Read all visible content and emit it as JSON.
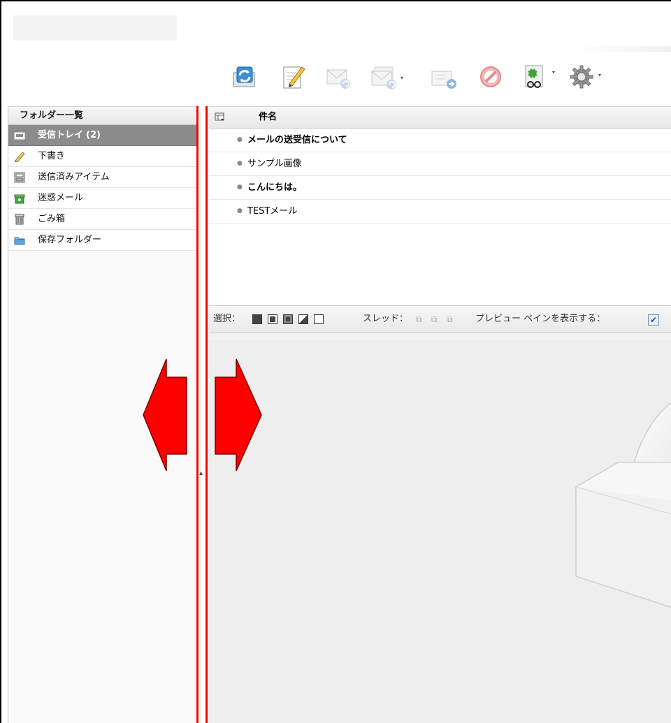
{
  "toolbar": {
    "buttons": [
      {
        "icon": "refresh-mail-icon",
        "enabled": true
      },
      {
        "icon": "compose-icon",
        "enabled": true
      },
      {
        "icon": "reply-icon",
        "enabled": false
      },
      {
        "icon": "reply-all-icon",
        "enabled": false
      },
      {
        "icon": "forward-icon",
        "enabled": false
      },
      {
        "icon": "delete-icon",
        "enabled": false
      },
      {
        "icon": "mark-icon",
        "enabled": true
      },
      {
        "icon": "settings-gear-icon",
        "enabled": true
      }
    ]
  },
  "folders": {
    "header": "フォルダー一覧",
    "items": [
      {
        "label": "受信トレイ",
        "count": "(2)",
        "icon": "inbox-icon",
        "selected": true
      },
      {
        "label": "下書き",
        "count": "",
        "icon": "pencil-icon",
        "selected": false
      },
      {
        "label": "送信済みアイテム",
        "count": "",
        "icon": "sent-icon",
        "selected": false
      },
      {
        "label": "迷惑メール",
        "count": "",
        "icon": "junk-icon",
        "selected": false
      },
      {
        "label": "ごみ箱",
        "count": "",
        "icon": "trash-icon",
        "selected": false
      },
      {
        "label": "保存フォルダー",
        "count": "",
        "icon": "folder-icon",
        "selected": false
      }
    ]
  },
  "mail_list": {
    "column_header": "件名",
    "rows": [
      {
        "subject": "メールの送受信について",
        "unread": true
      },
      {
        "subject": "サンプル画像",
        "unread": false
      },
      {
        "subject": "こんにちは。",
        "unread": true
      },
      {
        "subject": "TESTメール",
        "unread": false
      }
    ]
  },
  "select_bar": {
    "select_label": "選択：",
    "thread_label": "スレッド：",
    "preview_label": "プレビュー ペインを表示する：",
    "preview_checked": true
  },
  "colors": {
    "accent_red": "#ff0000",
    "selected_folder_bg": "#8c8c8c"
  }
}
